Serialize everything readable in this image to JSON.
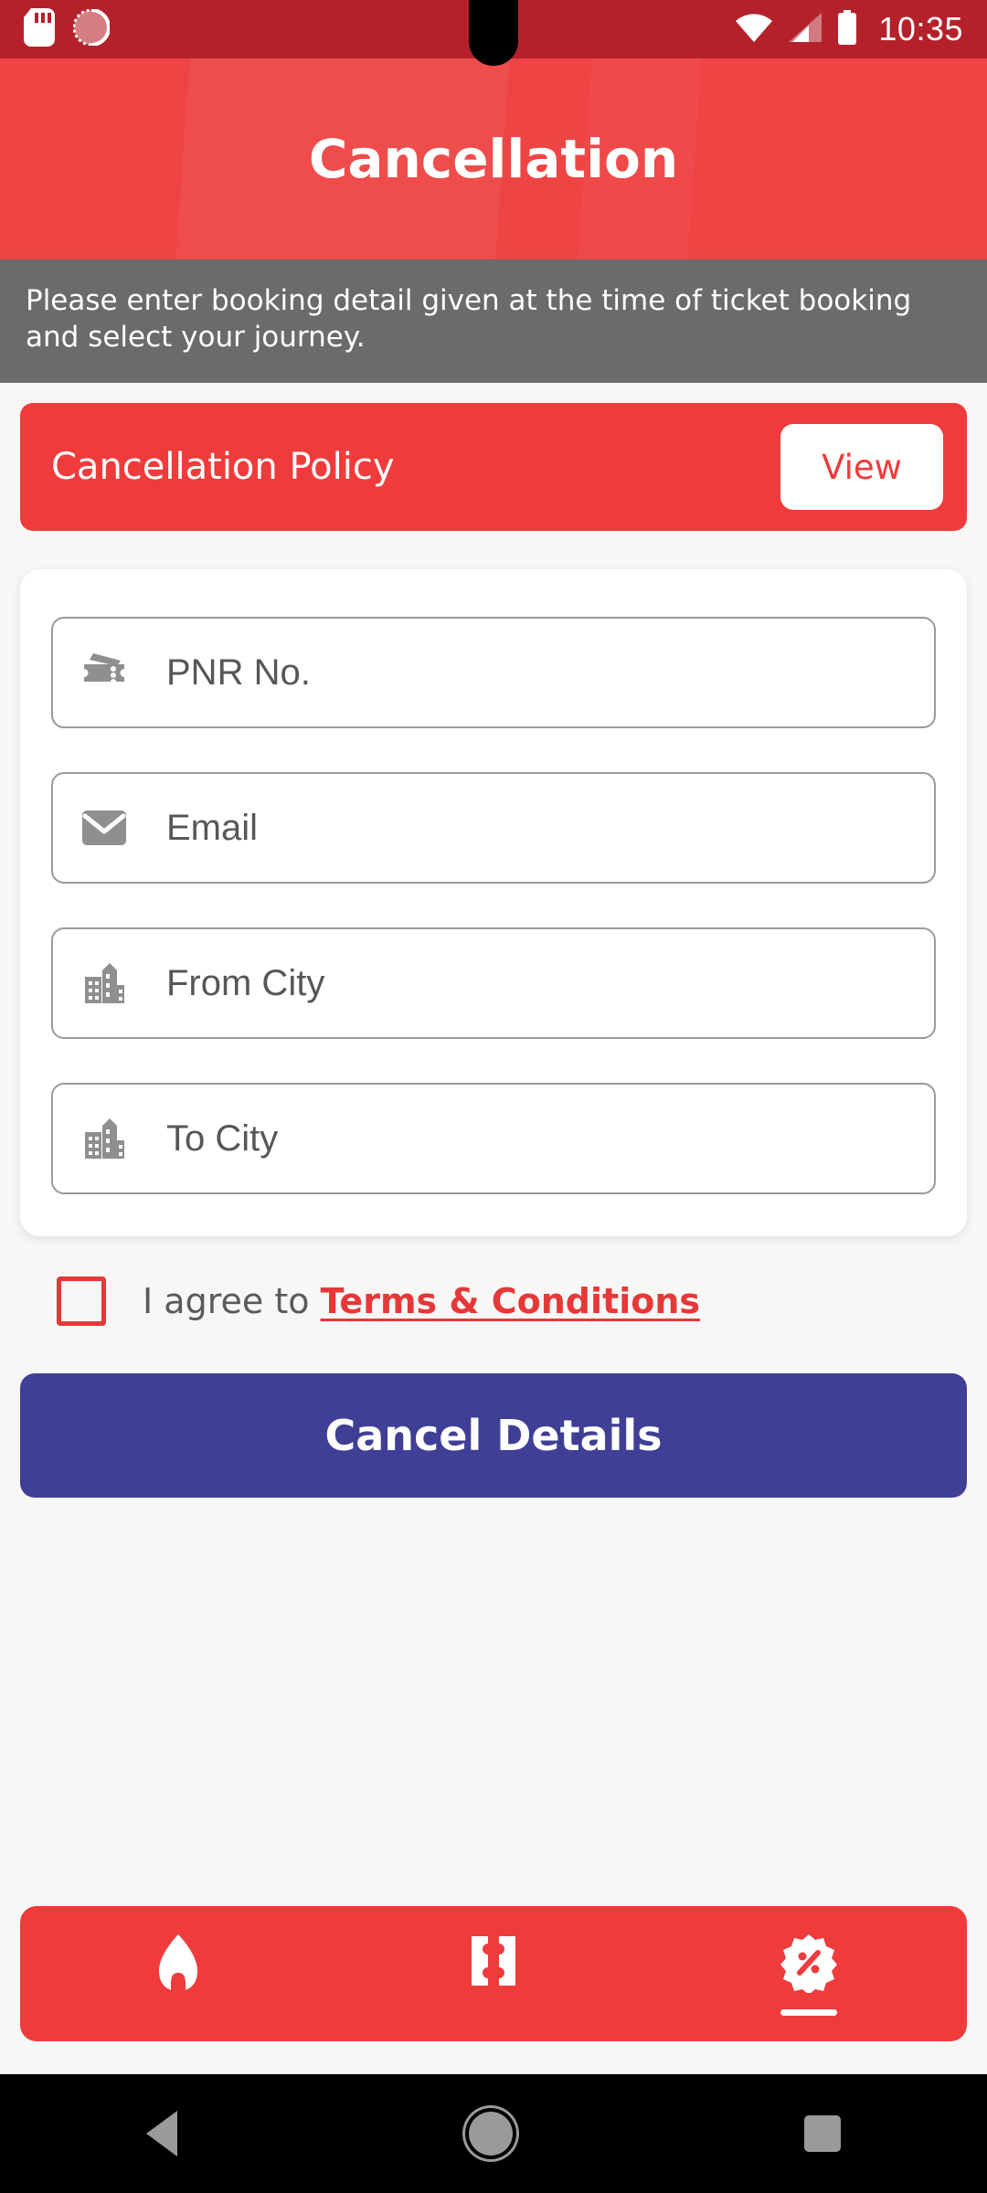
{
  "status_bar": {
    "time": "10:35",
    "left_icons": [
      "sd-card-icon",
      "sync-circle-icon"
    ],
    "right_icons": [
      "wifi-icon",
      "cellular-signal-icon",
      "battery-icon"
    ]
  },
  "header": {
    "title": "Cancellation",
    "background_color": "#ef4444"
  },
  "info_banner": {
    "text": "Please enter booking detail given at the time of ticket booking and select your journey.",
    "background_color": "#6b6b6b"
  },
  "policy": {
    "title": "Cancellation Policy",
    "view_label": "View",
    "background_color": "#ef3b3b"
  },
  "form": {
    "fields": [
      {
        "icon": "ticket-icon",
        "placeholder": "PNR No."
      },
      {
        "icon": "email-icon",
        "placeholder": "Email"
      },
      {
        "icon": "city-icon",
        "placeholder": "From City"
      },
      {
        "icon": "city-icon",
        "placeholder": "To City"
      }
    ]
  },
  "agreement": {
    "checked": false,
    "prefix": "I agree to",
    "link_label": "Terms & Conditions",
    "link_color": "#e63838"
  },
  "submit": {
    "label": "Cancel Details",
    "background_color": "#3f3f96"
  },
  "bottom_nav": {
    "background_color": "#ef3b3b",
    "items": [
      {
        "icon": "home-icon",
        "name": "home",
        "active": false
      },
      {
        "icon": "ticket-icon",
        "name": "ticket",
        "active": false
      },
      {
        "icon": "offer-percent-icon",
        "name": "offers",
        "active": true
      }
    ]
  },
  "system_nav": {
    "items": [
      "back-icon",
      "home-icon",
      "recents-icon"
    ]
  }
}
